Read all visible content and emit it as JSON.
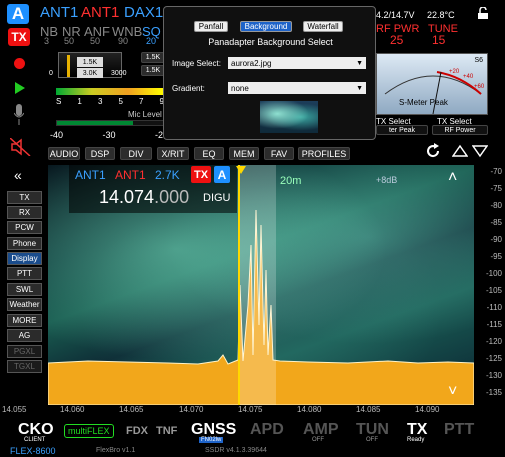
{
  "top": {
    "a_badge": "A",
    "tx_badge": "TX",
    "ant1": "ANT1",
    "ant2": "ANT1",
    "dax": "DAX1",
    "filters": [
      {
        "label": "NB",
        "value": "3"
      },
      {
        "label": "NR",
        "value": "50"
      },
      {
        "label": "ANF",
        "value": "50"
      },
      {
        "label": "WNB",
        "value": "90"
      },
      {
        "label": "SQ",
        "value": "20"
      }
    ],
    "volt": "4.2/14.7V",
    "temp": "22.8°C",
    "rfpwr_label": "RF PWR",
    "rfpwr_value": "25",
    "tune_label": "TUNE",
    "tune_value": "15"
  },
  "agc": {
    "box1": "1.5K",
    "box2": "3.0K",
    "min": "0",
    "max": "3000",
    "btn1": "1.5K",
    "btn2": "1.5K"
  },
  "smeter": {
    "scale": [
      "S",
      "1",
      "3",
      "5",
      "7",
      "9"
    ],
    "mic_label": "Mic Level",
    "mic_scale": [
      "-40",
      "-30",
      "-20"
    ],
    "s_label": "S6",
    "title": "S-Meter Peak",
    "tx_select": "TX Select",
    "tx_select2": "TX Select",
    "combo1": "ter Peak",
    "combo2": "RF Power",
    "p20": "+20",
    "p40": "+40",
    "p60": "+60"
  },
  "menu": [
    "AUDIO",
    "DSP",
    "DIV",
    "X/RIT",
    "EQ",
    "MEM",
    "FAV",
    "PROFILES"
  ],
  "side": [
    "TX",
    "RX",
    "PCW",
    "Phone",
    "Display",
    "PTT",
    "SWL",
    "Weather",
    "MORE",
    "AG",
    "PGXL",
    "TGXL"
  ],
  "slice": {
    "ant1": "ANT1",
    "ant2": "ANT1",
    "bw": "2.7K",
    "tx": "TX",
    "a": "A",
    "freq_main": "14.074",
    "freq_frac": ".000",
    "mode": "DIGU"
  },
  "pan": {
    "zoom": "20m",
    "db": "+8dB",
    "y_labels": [
      "-70",
      "-75",
      "-80",
      "-85",
      "-90",
      "-95",
      "-100",
      "-105",
      "-110",
      "-115",
      "-120",
      "-125",
      "-130",
      "-135"
    ],
    "x_labels": [
      "14.055",
      "14.060",
      "14.065",
      "14.070",
      "14.075",
      "14.080",
      "14.085",
      "14.090"
    ]
  },
  "dialog": {
    "tabs": [
      "Panfall",
      "Background",
      "Waterfall"
    ],
    "active_tab": "Background",
    "title": "Panadapter Background Select",
    "image_label": "Image Select:",
    "image_value": "aurora2.jpg",
    "gradient_label": "Gradient:",
    "gradient_value": "none"
  },
  "bottom": {
    "cko": "CKO",
    "cko_sub": "CLIENT",
    "multiflex": "multiFLEX",
    "fdx": "FDX",
    "tnf": "TNF",
    "gnss": "GNSS",
    "gnss_sub": "FN02lw",
    "apd": "APD",
    "amp": "AMP",
    "amp_sub": "OFF",
    "tun": "TUN",
    "tun_sub": "OFF",
    "tx": "TX",
    "tx_sub": "Ready",
    "ptt": "PTT",
    "model": "FLEX-8600",
    "ver1": "FlexBro v1.1",
    "ver2": "SSDR v4.1.3.39644"
  },
  "colors": {
    "accent": "#1e90ff",
    "red": "#ff2020",
    "orange": "#f2a71b",
    "dialog_bg": "#101010"
  }
}
